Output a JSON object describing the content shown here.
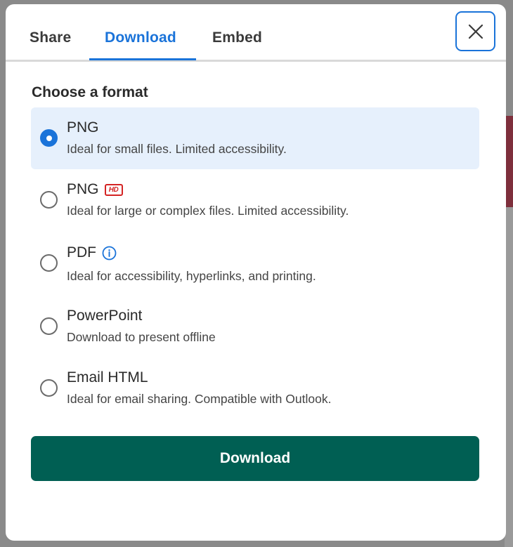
{
  "tabs": {
    "share": "Share",
    "download": "Download",
    "embed": "Embed",
    "active": "Download"
  },
  "section_title": "Choose a format",
  "options": [
    {
      "title": "PNG",
      "description": "Ideal for small files. Limited accessibility.",
      "selected": true
    },
    {
      "title": "PNG",
      "badge": "HD",
      "description": "Ideal for large or complex files. Limited accessibility.",
      "selected": false
    },
    {
      "title": "PDF",
      "icon": "info-icon",
      "description": "Ideal for accessibility, hyperlinks, and printing.",
      "selected": false
    },
    {
      "title": "PowerPoint",
      "description": "Download to present offline",
      "selected": false
    },
    {
      "title": "Email HTML",
      "description": "Ideal for email sharing. Compatible with Outlook.",
      "selected": false
    }
  ],
  "download_button": "Download",
  "colors": {
    "accent": "#1a73d9",
    "primary_button": "#005f53",
    "selected_bg": "#e6f0fc",
    "hd_badge": "#d42323"
  },
  "icons": {
    "close": "close-icon",
    "info": "info-icon"
  }
}
